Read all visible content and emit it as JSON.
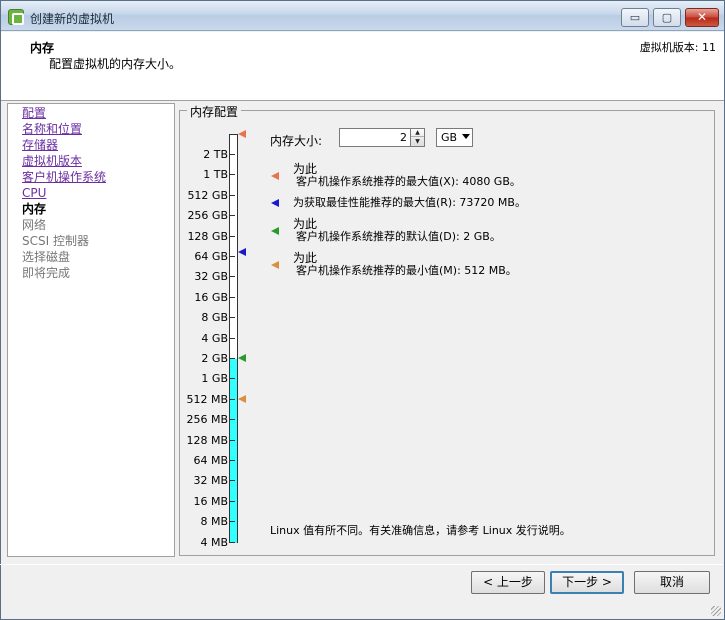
{
  "window": {
    "title": "创建新的虚拟机",
    "min_label": "▭",
    "max_label": "▢",
    "close_label": "✕"
  },
  "header": {
    "title": "内存",
    "subtitle": "配置虚拟机的内存大小。",
    "version": "虚拟机版本: 11"
  },
  "nav": {
    "items": [
      {
        "label": "配置",
        "state": "link"
      },
      {
        "label": "名称和位置",
        "state": "link"
      },
      {
        "label": "存储器",
        "state": "link"
      },
      {
        "label": "虚拟机版本",
        "state": "link"
      },
      {
        "label": "客户机操作系统",
        "state": "link"
      },
      {
        "label": "CPU",
        "state": "link"
      },
      {
        "label": "内存",
        "state": "current"
      },
      {
        "label": "网络",
        "state": "disabled"
      },
      {
        "label": "SCSI 控制器",
        "state": "disabled"
      },
      {
        "label": "选择磁盘",
        "state": "disabled"
      },
      {
        "label": "即将完成",
        "state": "disabled"
      }
    ]
  },
  "memory": {
    "group_title": "内存配置",
    "size_label": "内存大小:",
    "size_value": "2",
    "unit": "GB",
    "scale_labels": [
      "2 TB",
      "1 TB",
      "512 GB",
      "256 GB",
      "128 GB",
      "64 GB",
      "32 GB",
      "16 GB",
      "8 GB",
      "4 GB",
      "2 GB",
      "1 GB",
      "512 MB",
      "256 MB",
      "128 MB",
      "64 MB",
      "32 MB",
      "16 MB",
      "8 MB",
      "4 MB"
    ],
    "legend": [
      {
        "line1": "为此",
        "line2": "客户机操作系统推荐的最大值(X): 4080 GB。",
        "color": "#e8744a"
      },
      {
        "line1": "",
        "line2": "为获取最佳性能推荐的最大值(R): 73720 MB。",
        "color": "#1a1acc"
      },
      {
        "line1": "为此",
        "line2": "客户机操作系统推荐的默认值(D): 2 GB。",
        "color": "#2a9a2a"
      },
      {
        "line1": "为此",
        "line2": "客户机操作系统推荐的最小值(M): 512 MB。",
        "color": "#d89040"
      }
    ],
    "footnote": "Linux 值有所不同。有关准确信息，请参考 Linux 发行说明。"
  },
  "buttons": {
    "back": "< 上一步",
    "next": "下一步 >",
    "cancel": "取消"
  }
}
